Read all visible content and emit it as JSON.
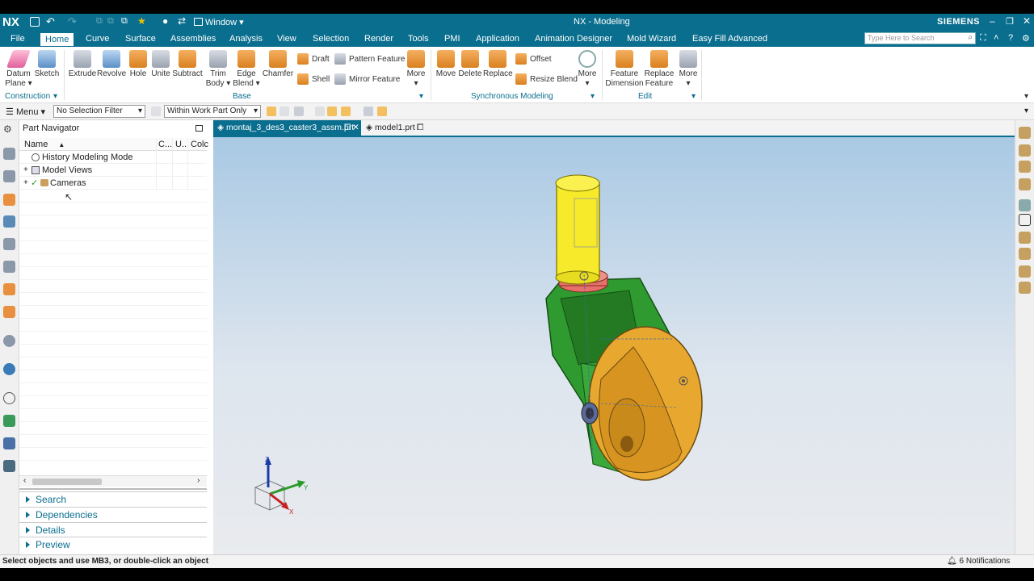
{
  "app": {
    "logo": "NX",
    "title": "NX - Modeling",
    "brand": "SIEMENS",
    "window_menu": "Window",
    "search_placeholder": "Type Here to Search"
  },
  "menu": [
    "File",
    "Home",
    "Curve",
    "Surface",
    "Assemblies",
    "Analysis",
    "View",
    "Selection",
    "Render",
    "Tools",
    "PMI",
    "Application",
    "Animation Designer",
    "Mold Wizard",
    "Easy Fill Advanced"
  ],
  "ribbon": {
    "construction": {
      "datum_plane": "Datum Plane",
      "sketch": "Sketch",
      "label": "Construction"
    },
    "base": {
      "extrude": "Extrude",
      "revolve": "Revolve",
      "hole": "Hole",
      "unite": "Unite",
      "subtract": "Subtract",
      "trim_body": "Trim Body",
      "edge_blend": "Edge Blend",
      "chamfer": "Chamfer",
      "draft": "Draft",
      "shell": "Shell",
      "pattern_feature": "Pattern Feature",
      "mirror_feature": "Mirror Feature",
      "more": "More",
      "label": "Base"
    },
    "sync": {
      "move": "Move",
      "delete": "Delete",
      "replace": "Replace",
      "offset": "Offset",
      "resize_blend": "Resize Blend",
      "more": "More",
      "label": "Synchronous Modeling"
    },
    "edit": {
      "feature_dimension": "Feature Dimension",
      "replace_feature": "Replace Feature",
      "more": "More",
      "label": "Edit"
    }
  },
  "selbar": {
    "menu": "Menu",
    "filter": "No Selection Filter",
    "scope": "Within Work Part Only"
  },
  "navigator": {
    "title": "Part Navigator",
    "columns": [
      "Name",
      "C...",
      "U...",
      "Colc"
    ],
    "rows": [
      "History Modeling Mode",
      "Model Views",
      "Cameras"
    ],
    "sections": [
      "Search",
      "Dependencies",
      "Details",
      "Preview"
    ]
  },
  "tabs": [
    {
      "label": "montaj_3_des3_caster3_assm.prt"
    },
    {
      "label": "model1.prt"
    }
  ],
  "triad": {
    "z": "Z",
    "y": "Y",
    "x": "X"
  },
  "status": {
    "prompt": "Select objects and use MB3, or double-click an object",
    "notifications": "6 Notifications"
  },
  "colors": {
    "accent": "#0a6e8e",
    "yellow": "#f6ea2a",
    "green": "#2f9a2f",
    "wheel": "#e8a830",
    "ring": "#e8706a"
  }
}
